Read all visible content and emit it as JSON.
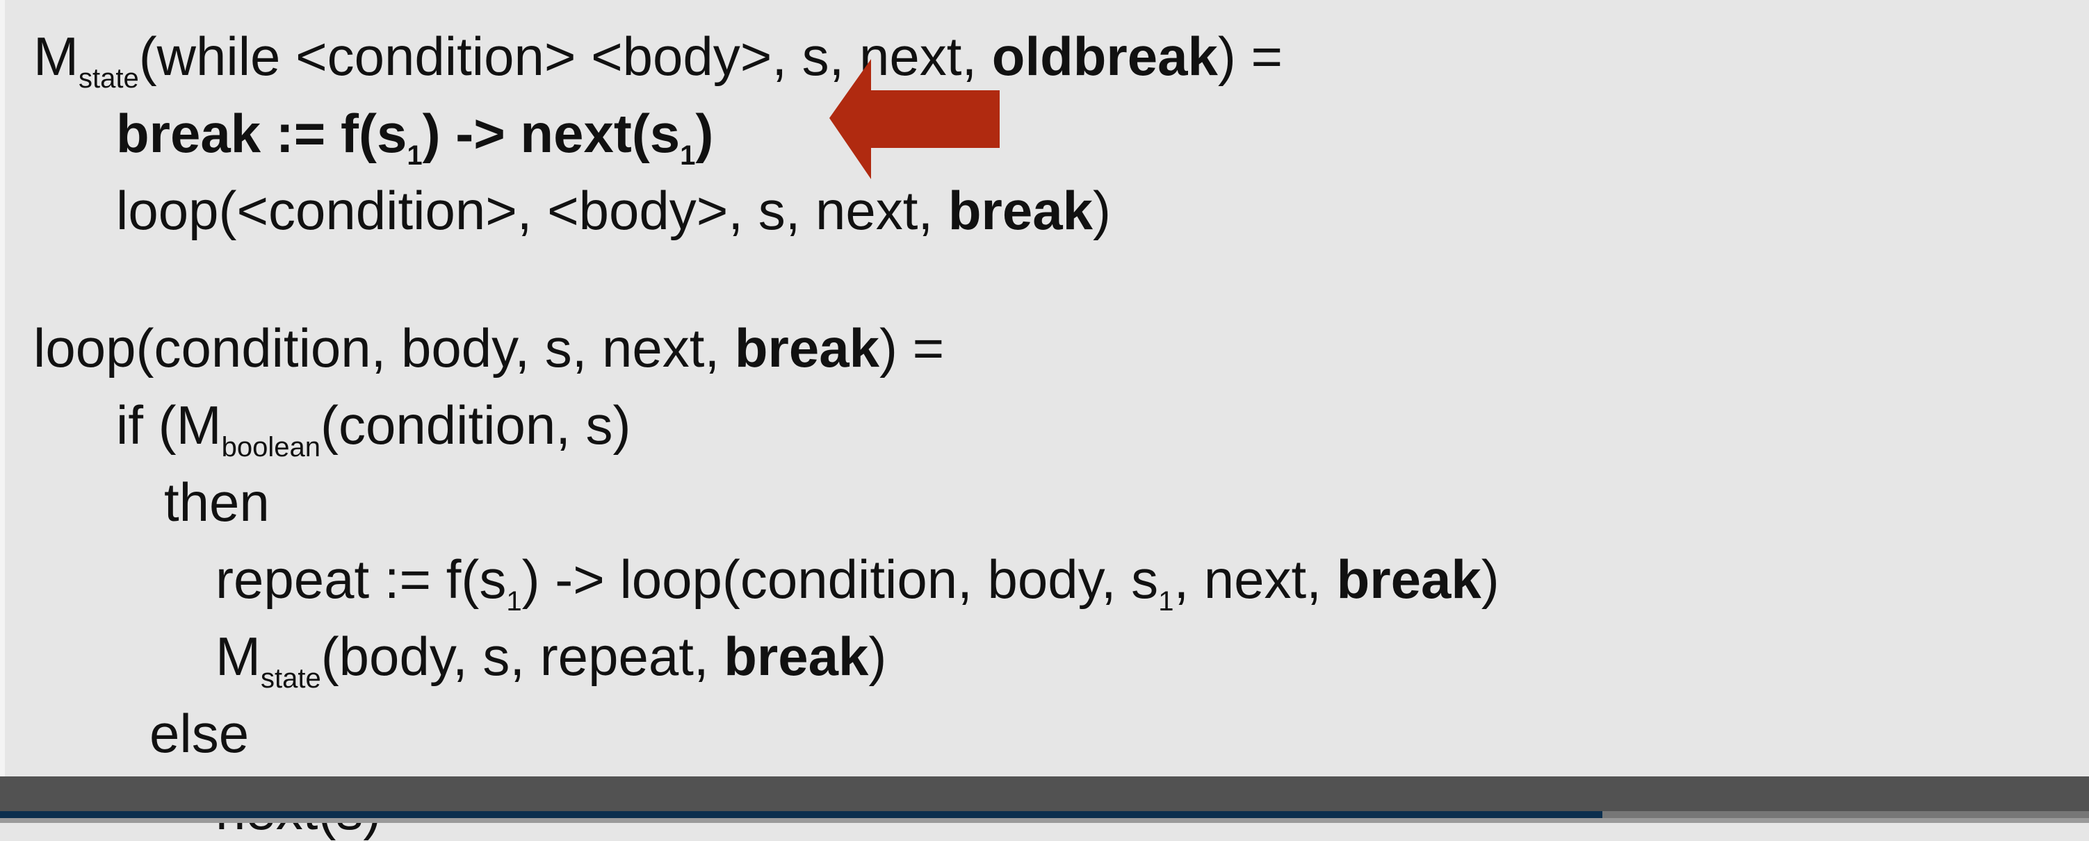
{
  "slide": {
    "lines": [
      {
        "indent": 0,
        "segs": [
          {
            "t": "M"
          },
          {
            "t": "state",
            "sub": true
          },
          {
            "t": "(while <condition> <body>, s, next, "
          },
          {
            "t": "oldbreak",
            "b": true
          },
          {
            "t": ") ="
          }
        ]
      },
      {
        "indent": 1,
        "segs": [
          {
            "t": "break := f(s",
            "b": true
          },
          {
            "t": "1",
            "b": true,
            "sub": true
          },
          {
            "t": ") -> next(s",
            "b": true
          },
          {
            "t": "1",
            "b": true,
            "sub": true
          },
          {
            "t": ")",
            "b": true
          }
        ]
      },
      {
        "indent": 1,
        "segs": [
          {
            "t": "loop(<condition>, <body>, s, next, "
          },
          {
            "t": "break",
            "b": true
          },
          {
            "t": ")"
          }
        ]
      },
      {
        "indent": 0,
        "gap": true,
        "segs": [
          {
            "t": "loop(condition, body, s, next, "
          },
          {
            "t": "break",
            "b": true
          },
          {
            "t": ") ="
          }
        ]
      },
      {
        "indent": 1,
        "segs": [
          {
            "t": "if (M"
          },
          {
            "t": "boolean",
            "sub": true
          },
          {
            "t": "(condition, s)"
          }
        ]
      },
      {
        "indent": 2,
        "segs": [
          {
            "t": "then"
          }
        ]
      },
      {
        "indent": 3,
        "segs": [
          {
            "t": "repeat := f(s"
          },
          {
            "t": "1",
            "sub": true
          },
          {
            "t": ") -> loop(condition, body, s"
          },
          {
            "t": "1",
            "sub": true
          },
          {
            "t": ", next, "
          },
          {
            "t": "break",
            "b": true
          },
          {
            "t": ")"
          }
        ]
      },
      {
        "indent": 3,
        "segs": [
          {
            "t": "M"
          },
          {
            "t": "state",
            "sub": true
          },
          {
            "t": "(body, s, repeat, "
          },
          {
            "t": "break",
            "b": true
          },
          {
            "t": ")"
          }
        ]
      },
      {
        "indent": 4,
        "segs": [
          {
            "t": "else"
          }
        ]
      },
      {
        "indent": 3,
        "segs": [
          {
            "t": "next(s)"
          }
        ]
      }
    ],
    "arrow_icon": "left-arrow-icon",
    "arrow_color": "#b02a10"
  },
  "player": {
    "progress_percent": 76.7,
    "progress_color": "#0c2f4e"
  }
}
